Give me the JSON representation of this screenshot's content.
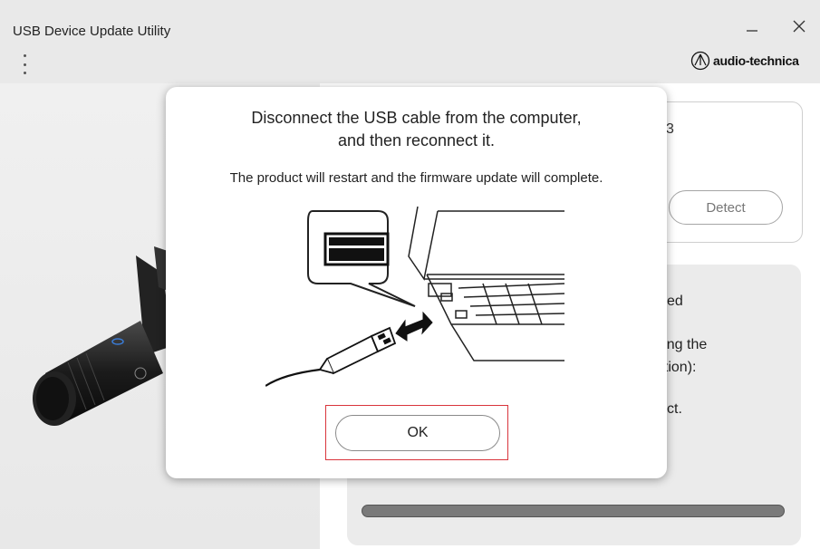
{
  "window": {
    "title": "USB Device Update Utility",
    "minimize_glyph": "—",
    "close_glyph": "✕"
  },
  "brand": {
    "name": "audio-technica",
    "logo_icon": "audio-technica-logo-icon"
  },
  "background": {
    "card_fragment": "3",
    "detect_label": "Detect",
    "fragments": [
      "ed",
      "uring the",
      "nction):",
      "ct."
    ]
  },
  "dialog": {
    "message_line1": "Disconnect the USB cable from the computer,",
    "message_line2": "and then reconnect it.",
    "detail": "The product will restart and the firmware update will complete.",
    "ok_label": "OK"
  },
  "colors": {
    "highlight": "#d9353c",
    "titlebar": "#e9e9e9"
  }
}
